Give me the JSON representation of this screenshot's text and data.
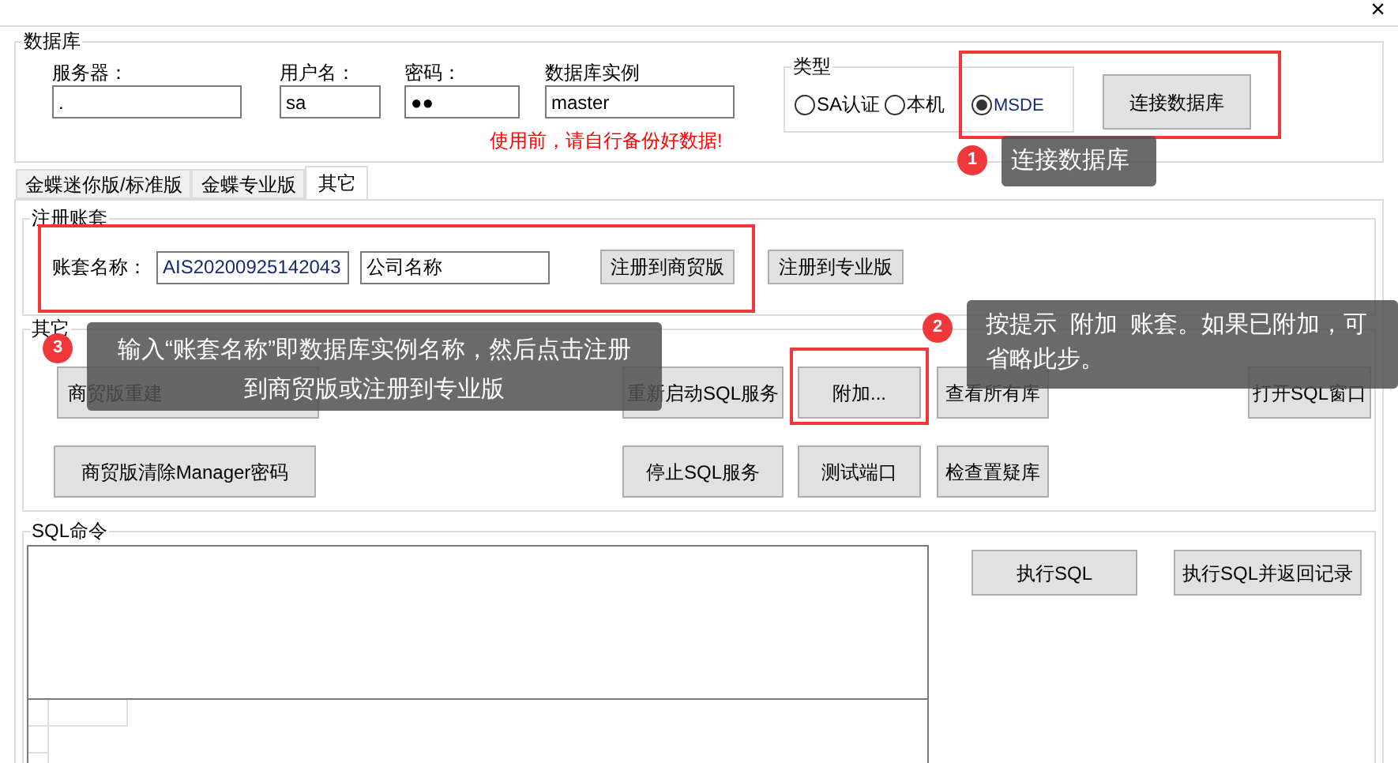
{
  "window": {
    "close": "×"
  },
  "database": {
    "title": "数据库",
    "fields": [
      {
        "label": "服务器：",
        "value": "."
      },
      {
        "label": "用户名：",
        "value": "sa"
      },
      {
        "label": "密码：",
        "value": "●●"
      },
      {
        "label": "数据库实例",
        "value": "master"
      }
    ],
    "warning": "使用前，请自行备份好数据!",
    "type_group": {
      "title": "类型",
      "options": [
        {
          "label": "SA认证",
          "selected": false
        },
        {
          "label": "本机",
          "selected": false
        },
        {
          "label": "MSDE",
          "selected": true
        }
      ]
    },
    "connect_button": "连接数据库"
  },
  "tabs": [
    {
      "label": "金蝶迷你版/标准版",
      "selected": false
    },
    {
      "label": "金蝶专业版",
      "selected": false
    },
    {
      "label": "其它",
      "selected": true
    }
  ],
  "register": {
    "title": "注册账套",
    "label": "账套名称：",
    "account": "AIS20200925142043",
    "company": "公司名称",
    "buttons": [
      "注册到商贸版",
      "注册到专业版"
    ]
  },
  "other": {
    "title": "其它",
    "rows": [
      [
        "商贸版重建",
        "重新启动SQL服务",
        "附加...",
        "查看所有库",
        "打开SQL窗口"
      ],
      [
        "商贸版清除Manager密码",
        "停止SQL服务",
        "测试端口",
        "检查置疑库"
      ]
    ]
  },
  "sql": {
    "title": "SQL命令",
    "buttons": [
      "执行SQL",
      "执行SQL并返回记录"
    ]
  },
  "callouts": [
    {
      "number": "1",
      "text": "连接数据库"
    },
    {
      "number": "2",
      "text": "按提示  附加  账套。如果已附加，可省略此步。"
    },
    {
      "number": "3",
      "text": "输入“账套名称”即数据库实例名称，然后点击注册到商贸版或注册到专业版"
    }
  ]
}
